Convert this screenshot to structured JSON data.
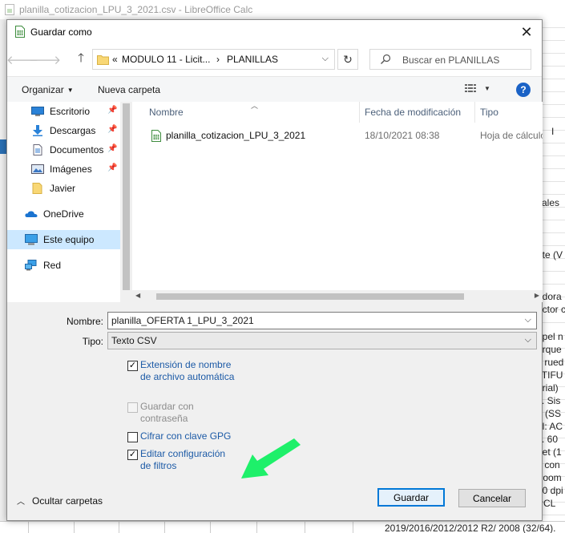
{
  "background_window": {
    "title": "planilla_cotizacion_LPU_3_2021.csv - LibreOffice Calc",
    "right_fragments": [
      "cales",
      "nte (V",
      "adora",
      "ector c",
      "apel n",
      "arque",
      "y rued",
      "LTIFU",
      "orial)",
      "s. Sis",
      "o (SS",
      "el: AC",
      "s. 60",
      "net (1",
      "y con",
      "Zoom",
      "00 dpi",
      "PCL",
      "I"
    ],
    "bottom_text": "2019/2016/2012/2012 R2/ 2008 (32/64)."
  },
  "dialog": {
    "title": "Guardar como",
    "close_symbol": "✕",
    "address": {
      "overflow": "«",
      "crumbs": [
        "MODULO 11 - Licit...",
        "PLANILLAS"
      ],
      "separator": "›"
    },
    "search_placeholder": "Buscar en PLANILLAS",
    "toolbar": {
      "organize": "Organizar",
      "new_folder": "Nueva carpeta",
      "help": "?"
    },
    "nav_items": [
      {
        "label": "Escritorio",
        "icon": "desktop-icon",
        "pinned": true
      },
      {
        "label": "Descargas",
        "icon": "downloads-icon",
        "pinned": true
      },
      {
        "label": "Documentos",
        "icon": "documents-icon",
        "pinned": true
      },
      {
        "label": "Imágenes",
        "icon": "pictures-icon",
        "pinned": true
      },
      {
        "label": "Javier",
        "icon": "folder-icon",
        "pinned": false
      },
      {
        "label": "OneDrive",
        "icon": "onedrive-icon",
        "pinned": false
      },
      {
        "label": "Este equipo",
        "icon": "computer-icon",
        "pinned": false,
        "selected": true
      },
      {
        "label": "Red",
        "icon": "network-icon",
        "pinned": false
      }
    ],
    "columns": {
      "name": "Nombre",
      "date": "Fecha de modificación",
      "type": "Tipo"
    },
    "files": [
      {
        "name": "planilla_cotizacion_LPU_3_2021",
        "date": "18/10/2021 08:38",
        "type": "Hoja de cálculo",
        "icon": "spreadsheet-icon"
      }
    ],
    "form": {
      "name_label": "Nombre:",
      "name_value": "planilla_OFERTA 1_LPU_3_2021",
      "type_label": "Tipo:",
      "type_value": "Texto CSV"
    },
    "options": {
      "auto_ext": {
        "line1": "Extensión de nombre",
        "line2": "de archivo automática",
        "checked": true
      },
      "password": {
        "line1": "Guardar con",
        "line2": "contraseña",
        "checked": false,
        "disabled": true
      },
      "gpg": {
        "label": "Cifrar con clave GPG",
        "checked": false
      },
      "filter": {
        "line1": "Editar configuración",
        "line2": "de filtros",
        "checked": true
      }
    },
    "hide_folders": "Ocultar carpetas",
    "buttons": {
      "save": "Guardar",
      "cancel": "Cancelar"
    },
    "colors": {
      "accent": "#0078d7",
      "link_blue": "#1c5aa6",
      "selection": "#cce8ff",
      "annotation_arrow": "#1ef06a"
    }
  }
}
